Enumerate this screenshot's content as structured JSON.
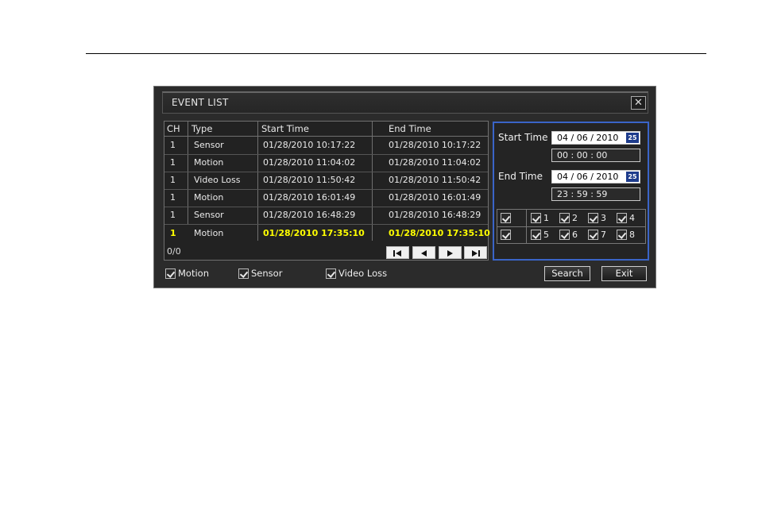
{
  "window": {
    "title": "EVENT LIST",
    "close_symbol": "✕"
  },
  "table": {
    "columns": [
      "CH",
      "Type",
      "Start Time",
      "End Time"
    ],
    "rows": [
      {
        "ch": "1",
        "type": "Sensor",
        "start": "01/28/2010  10:17:22",
        "end": "01/28/2010  10:17:22"
      },
      {
        "ch": "1",
        "type": "Motion",
        "start": "01/28/2010  11:04:02",
        "end": "01/28/2010  11:04:02"
      },
      {
        "ch": "1",
        "type": "Video Loss",
        "start": "01/28/2010  11:50:42",
        "end": "01/28/2010  11:50:42"
      },
      {
        "ch": "1",
        "type": "Motion",
        "start": "01/28/2010  16:01:49",
        "end": "01/28/2010  16:01:49"
      },
      {
        "ch": "1",
        "type": "Sensor",
        "start": "01/28/2010  16:48:29",
        "end": "01/28/2010  16:48:29"
      },
      {
        "ch": "1",
        "type": "Motion",
        "start": "01/28/2010  17:35:10",
        "end": "01/28/2010  17:35:10"
      }
    ],
    "selected_row_index": 5,
    "page_indicator": "0/0"
  },
  "search": {
    "start_label": "Start Time",
    "start_date": "04  /  06  /  2010",
    "start_time": "00   :   00   :   00",
    "end_label": "End Time",
    "end_date": "04  /  06  /  2010",
    "end_time": "23   :   59   :   59",
    "calendar_icon_text": "25",
    "channels": [
      "1",
      "2",
      "3",
      "4",
      "5",
      "6",
      "7",
      "8"
    ]
  },
  "filters": {
    "motion": "Motion",
    "sensor": "Sensor",
    "video_loss": "Video Loss"
  },
  "buttons": {
    "search": "Search",
    "exit": "Exit"
  },
  "colors": {
    "highlight_text": "#ffff00",
    "panel_border": "#3a64c8",
    "background": "#2b2b2b"
  }
}
